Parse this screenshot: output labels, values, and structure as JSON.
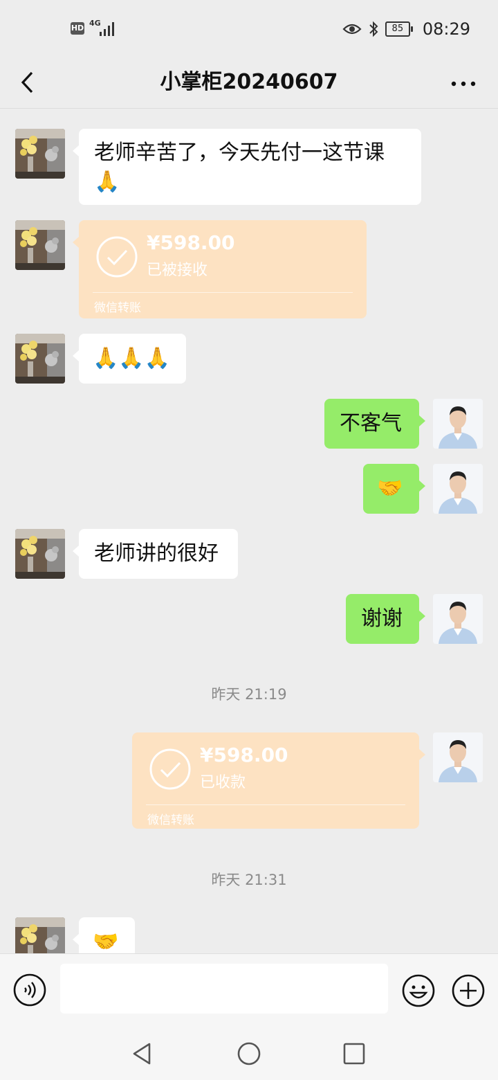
{
  "status_bar": {
    "hd": "HD",
    "network": "4G",
    "battery": "85",
    "time": "08:29"
  },
  "header": {
    "title": "小掌柜20240607"
  },
  "messages": [
    {
      "side": "left",
      "type": "text",
      "text": "老师辛苦了，今天先付一这节课",
      "emoji": "🙏"
    },
    {
      "side": "left",
      "type": "transfer",
      "amount": "¥598.00",
      "status": "已被接收",
      "footer": "微信转账"
    },
    {
      "side": "left",
      "type": "emoji",
      "text": "🙏🙏🙏"
    },
    {
      "side": "right",
      "type": "text",
      "text": "不客气"
    },
    {
      "side": "right",
      "type": "emoji",
      "text": "🤝"
    },
    {
      "side": "left",
      "type": "text",
      "text": "老师讲的很好"
    },
    {
      "side": "right",
      "type": "text",
      "text": "谢谢"
    },
    {
      "type": "timestamp",
      "text": "昨天 21:19"
    },
    {
      "side": "right",
      "type": "transfer",
      "amount": "¥598.00",
      "status": "已收款",
      "footer": "微信转账"
    },
    {
      "type": "timestamp",
      "text": "昨天 21:31"
    },
    {
      "side": "left",
      "type": "emoji",
      "text": "🤝"
    }
  ],
  "input": {
    "placeholder": ""
  },
  "colors": {
    "background": "#ededed",
    "sent_bubble": "#95ec69",
    "received_bubble": "#ffffff",
    "transfer_card": "#fde2c2"
  },
  "icons": {
    "back": "chevron-left-icon",
    "more": "more-dots-icon",
    "voice": "voice-icon",
    "emoji": "smiley-icon",
    "plus": "plus-icon",
    "nav_back": "triangle-back-icon",
    "nav_home": "circle-home-icon",
    "nav_recent": "square-recent-icon"
  }
}
